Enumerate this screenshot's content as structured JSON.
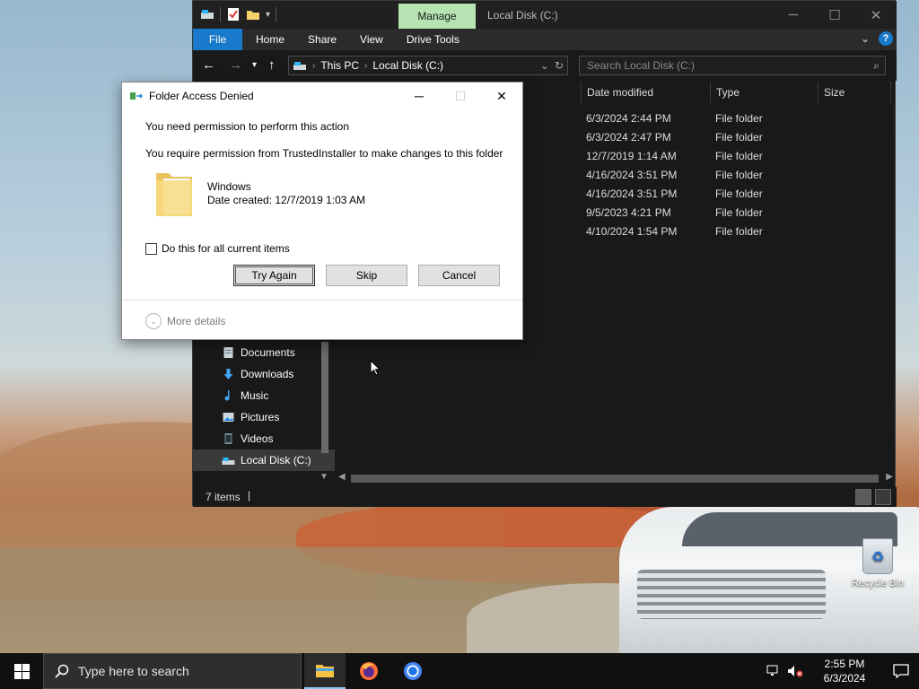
{
  "colors": {
    "manage_tab": "#b6e3b2",
    "file_tab": "#1979ca",
    "explorer_bg": "#191919",
    "taskbar_bg": "#101010"
  },
  "desktop": {
    "recycle_bin_label": "Recycle Bin"
  },
  "explorer": {
    "manage_tab": "Manage",
    "title": "Local Disk (C:)",
    "ribbon": {
      "file": "File",
      "tabs": [
        "Home",
        "Share",
        "View",
        "Drive Tools"
      ]
    },
    "address": {
      "crumbs": [
        "This PC",
        "Local Disk (C:)"
      ]
    },
    "search_placeholder": "Search Local Disk (C:)",
    "columns": [
      "Date modified",
      "Type",
      "Size"
    ],
    "rows": [
      {
        "date": "6/3/2024 2:44 PM",
        "type": "File folder"
      },
      {
        "date": "6/3/2024 2:47 PM",
        "type": "File folder"
      },
      {
        "date": "12/7/2019 1:14 AM",
        "type": "File folder"
      },
      {
        "date": "4/16/2024 3:51 PM",
        "type": "File folder"
      },
      {
        "date": "4/16/2024 3:51 PM",
        "type": "File folder"
      },
      {
        "date": "9/5/2023 4:21 PM",
        "type": "File folder"
      },
      {
        "date": "4/10/2024 1:54 PM",
        "type": "File folder"
      }
    ],
    "nav_items": [
      "Documents",
      "Downloads",
      "Music",
      "Pictures",
      "Videos",
      "Local Disk (C:)"
    ],
    "status_count": "7 items"
  },
  "dialog": {
    "title": "Folder Access Denied",
    "heading": "You need permission to perform this action",
    "message": "You require permission from TrustedInstaller to make changes to this folder",
    "folder_name": "Windows",
    "folder_date": "Date created: 12/7/2019 1:03 AM",
    "checkbox_label": "Do this for all current items",
    "buttons": {
      "try_again": "Try Again",
      "skip": "Skip",
      "cancel": "Cancel"
    },
    "more_details": "More details"
  },
  "taskbar": {
    "search_placeholder": "Type here to search",
    "time": "2:55 PM",
    "date": "6/3/2024"
  }
}
